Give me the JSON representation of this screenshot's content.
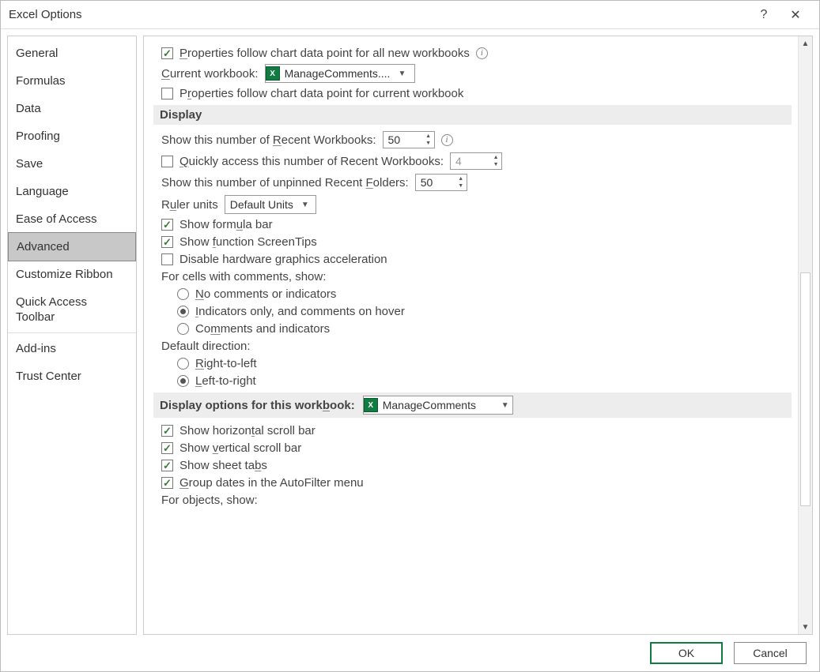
{
  "window": {
    "title": "Excel Options",
    "help_tooltip": "?",
    "close_tooltip": "✕"
  },
  "sidebar": {
    "items": [
      {
        "label": "General"
      },
      {
        "label": "Formulas"
      },
      {
        "label": "Data"
      },
      {
        "label": "Proofing"
      },
      {
        "label": "Save"
      },
      {
        "label": "Language"
      },
      {
        "label": "Ease of Access"
      },
      {
        "label": "Advanced",
        "selected": true
      },
      {
        "label": "Customize Ribbon"
      },
      {
        "label": "Quick Access Toolbar"
      },
      {
        "label": "Add-ins"
      },
      {
        "label": "Trust Center"
      }
    ]
  },
  "chart_section": {
    "cb_all_new": {
      "checked": true,
      "label_pre": "P",
      "label_post": "roperties follow chart data point for all new workbooks"
    },
    "current_workbook_label": "Current workbook:",
    "current_workbook_value": "ManageComments....",
    "cb_current": {
      "checked": false,
      "label_pre": "P",
      "label_u": "r",
      "label_post": "operties follow chart data point for current workbook"
    }
  },
  "display": {
    "header": "Display",
    "recent_wb_label_pre": "Show this number of ",
    "recent_wb_label_u": "R",
    "recent_wb_label_post": "ecent Workbooks:",
    "recent_wb_value": "50",
    "quick_access": {
      "checked": false,
      "label_pre": "",
      "label_u": "Q",
      "label_post": "uickly access this number of Recent Workbooks:",
      "value": "4"
    },
    "recent_folders_label_pre": "Show this number of unpinned Recent ",
    "recent_folders_label_u": "F",
    "recent_folders_label_post": "olders:",
    "recent_folders_value": "50",
    "ruler_label_pre": "R",
    "ruler_label_u": "u",
    "ruler_label_post": "ler units",
    "ruler_value": "Default Units",
    "cb_formula_bar": {
      "checked": true,
      "pre": "Show form",
      "u": "u",
      "post": "la bar"
    },
    "cb_screentips": {
      "checked": true,
      "pre": "Show ",
      "u": "f",
      "post": "unction ScreenTips"
    },
    "cb_hw_accel": {
      "checked": false,
      "pre": "Disable hardware ",
      "u": "g",
      "post": "raphics acceleration"
    },
    "comments_header": "For cells with comments, show:",
    "r_no_comments": {
      "checked": false,
      "u": "N",
      "post": "o comments or indicators"
    },
    "r_indicators": {
      "checked": true,
      "u": "I",
      "post": "ndicators only, and comments on hover"
    },
    "r_comments_ind": {
      "checked": false,
      "pre": "Co",
      "u": "m",
      "post": "ments and indicators"
    },
    "direction_header": "Default direction:",
    "r_rtl": {
      "checked": false,
      "u": "R",
      "post": "ight-to-left"
    },
    "r_ltr": {
      "checked": true,
      "u": "L",
      "post": "eft-to-right"
    }
  },
  "display_workbook": {
    "header": "Display options for this workbook:",
    "header_u_index": "b",
    "value": "ManageComments",
    "cb_hscroll": {
      "checked": true,
      "pre": "Show horizon",
      "u": "t",
      "post": "al scroll bar"
    },
    "cb_vscroll": {
      "checked": true,
      "pre": "Show ",
      "u": "v",
      "post": "ertical scroll bar"
    },
    "cb_tabs": {
      "checked": true,
      "pre": "Show sheet ta",
      "u": "b",
      "post": "s"
    },
    "cb_group_dates": {
      "checked": true,
      "u": "G",
      "post": "roup dates in the AutoFilter menu"
    },
    "objects_header": "For objects, show:"
  },
  "footer": {
    "ok": "OK",
    "cancel": "Cancel"
  }
}
